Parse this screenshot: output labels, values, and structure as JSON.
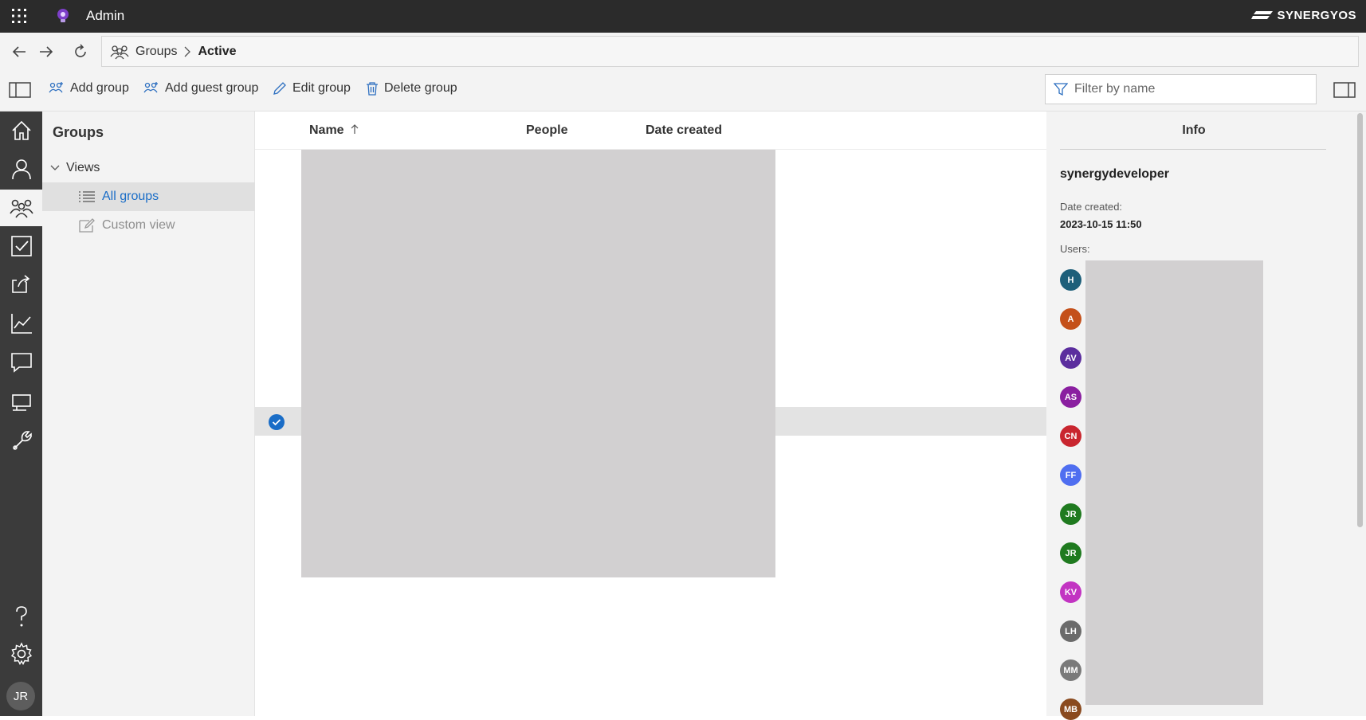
{
  "topbar": {
    "app_title": "Admin",
    "brand": "SYNERGYOS",
    "waffle_icon": "app-launcher-icon",
    "app_icon": "lightbulb-icon"
  },
  "nav": {
    "back_icon": "back-arrow-icon",
    "forward_icon": "forward-arrow-icon",
    "refresh_icon": "refresh-icon"
  },
  "breadcrumb": {
    "root": "Groups",
    "current": "Active"
  },
  "toolbar": {
    "add_group": "Add group",
    "add_guest_group": "Add guest group",
    "edit_group": "Edit group",
    "delete_group": "Delete group",
    "filter_placeholder": "Filter by name"
  },
  "sidepanel": {
    "title": "Groups",
    "views_label": "Views",
    "items": [
      {
        "label": "All groups",
        "selected": true
      },
      {
        "label": "Custom view",
        "selected": false
      }
    ]
  },
  "rail": {
    "items": [
      "home-icon",
      "user-icon",
      "groups-icon",
      "tasks-icon",
      "share-icon",
      "reports-icon",
      "chat-icon",
      "devices-icon",
      "tools-icon"
    ],
    "bottom": [
      "help-icon",
      "settings-icon"
    ],
    "user_initials": "JR"
  },
  "grid": {
    "columns": [
      {
        "label": "Name",
        "sort": "ascending"
      },
      {
        "label": "People"
      },
      {
        "label": "Date created"
      }
    ]
  },
  "info": {
    "title": "Info",
    "group_name": "synergydeveloper",
    "date_created_label": "Date created:",
    "date_created_value": "2023-10-15 11:50",
    "users_label": "Users:",
    "users": [
      {
        "initials": "H",
        "color": "#1d5f7a"
      },
      {
        "initials": "A",
        "color": "#c4501a"
      },
      {
        "initials": "AV",
        "color": "#5b2d9e"
      },
      {
        "initials": "AS",
        "color": "#8a1fa0"
      },
      {
        "initials": "CN",
        "color": "#c9262f"
      },
      {
        "initials": "FF",
        "color": "#4f6ef0"
      },
      {
        "initials": "JR",
        "color": "#1f7a1f"
      },
      {
        "initials": "JR",
        "color": "#1f7a1f"
      },
      {
        "initials": "KV",
        "color": "#c234c2"
      },
      {
        "initials": "LH",
        "color": "#6b6b6b"
      },
      {
        "initials": "MM",
        "color": "#7a7a7a"
      },
      {
        "initials": "MB",
        "color": "#8a4a1f"
      }
    ]
  },
  "colors": {
    "accent": "#1a6dc7",
    "topbar": "#2b2b2b",
    "rail": "#3b3b3b"
  }
}
